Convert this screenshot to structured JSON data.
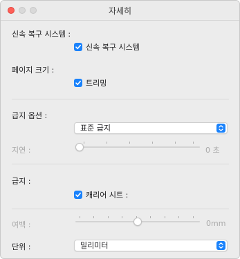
{
  "window": {
    "title": "자세히"
  },
  "quick_recovery": {
    "label": "신속 복구 시스템 :",
    "checkbox_label": "신속 복구 시스템",
    "checked": true
  },
  "page_size": {
    "label": "페이지 크기 :",
    "checkbox_label": "트리밍",
    "checked": true
  },
  "feed_options": {
    "label": "급지 옵션 :",
    "selected": "표준 급지"
  },
  "delay": {
    "label": "지연 :",
    "value_text": "0 초",
    "level": 0
  },
  "feed": {
    "label": "급지 :",
    "checkbox_label": "캐리어 시트 :",
    "checked": true
  },
  "margin": {
    "label": "여백 :",
    "value_text": "0mm",
    "level": 0.5
  },
  "units": {
    "label": "단위 :",
    "selected": "밀리미터"
  },
  "colors": {
    "accent": "#1a82fb"
  }
}
